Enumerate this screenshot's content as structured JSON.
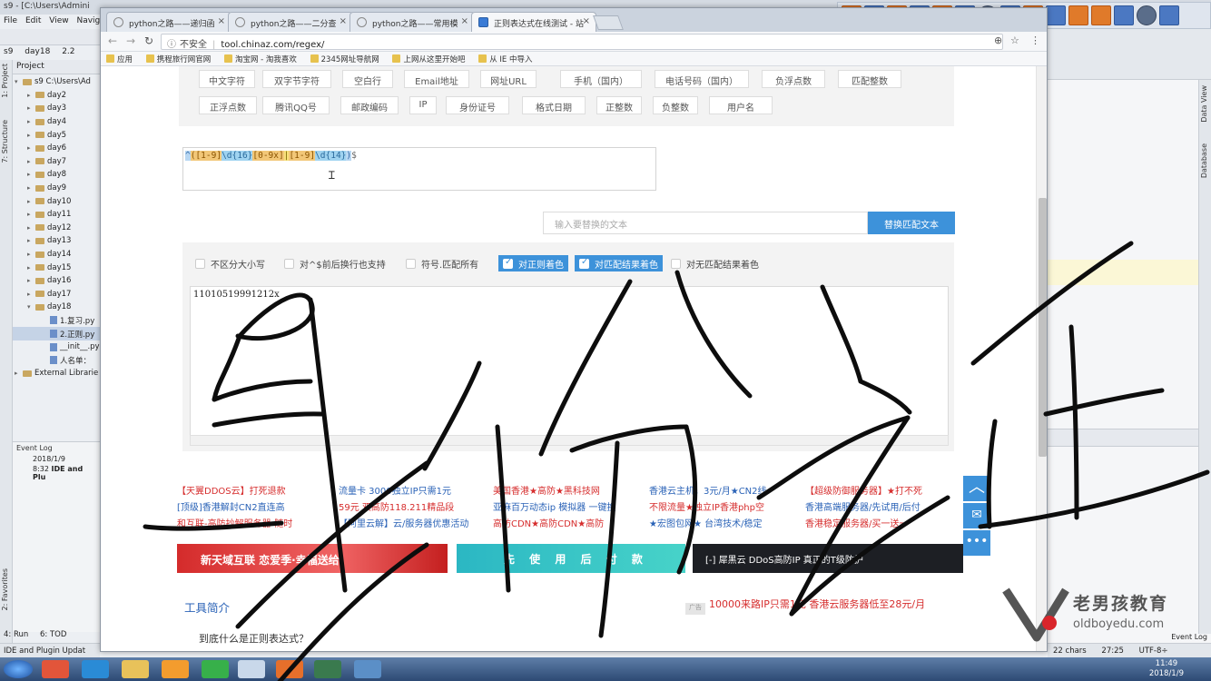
{
  "ide": {
    "title": "s9 - [C:\\Users\\Admini",
    "menu": [
      "File",
      "Edit",
      "View",
      "Navigat"
    ],
    "crumbs": [
      "s9",
      "day18",
      "2.2"
    ],
    "project_label": "Project",
    "tree": [
      {
        "label": "s9  C:\\Users\\Ad",
        "kind": "root",
        "open": true
      },
      {
        "label": "day2",
        "kind": "folder"
      },
      {
        "label": "day3",
        "kind": "folder"
      },
      {
        "label": "day4",
        "kind": "folder"
      },
      {
        "label": "day5",
        "kind": "folder"
      },
      {
        "label": "day6",
        "kind": "folder"
      },
      {
        "label": "day7",
        "kind": "folder"
      },
      {
        "label": "day8",
        "kind": "folder"
      },
      {
        "label": "day9",
        "kind": "folder"
      },
      {
        "label": "day10",
        "kind": "folder"
      },
      {
        "label": "day11",
        "kind": "folder"
      },
      {
        "label": "day12",
        "kind": "folder"
      },
      {
        "label": "day13",
        "kind": "folder"
      },
      {
        "label": "day14",
        "kind": "folder"
      },
      {
        "label": "day15",
        "kind": "folder"
      },
      {
        "label": "day16",
        "kind": "folder"
      },
      {
        "label": "day17",
        "kind": "folder"
      },
      {
        "label": "day18",
        "kind": "folder",
        "open": true
      },
      {
        "label": "1.复习.py",
        "kind": "file"
      },
      {
        "label": "2.正则.py",
        "kind": "file",
        "selected": true
      },
      {
        "label": "__init__.py",
        "kind": "file"
      },
      {
        "label": "人名单：",
        "kind": "file"
      },
      {
        "label": "External Librarie",
        "kind": "lib"
      }
    ],
    "event_log": {
      "title": "Event Log",
      "date": "2018/1/9",
      "time": "8:32",
      "msg": "IDE and Plu"
    },
    "bottom_tabs": [
      "4: Run",
      "6: TOD"
    ],
    "status": "IDE and Plugin Updat",
    "side_labels": [
      "1: Project",
      "7: Structure",
      "2: Favorites"
    ],
    "right_labels": [
      "Data View",
      "Database"
    ],
    "right_status": {
      "chars": "22 chars",
      "pos": "27:25",
      "enc": "UTF-8÷"
    },
    "event_log_btn": "Event Log"
  },
  "browser": {
    "tabs": [
      {
        "label": "python之路——递归函"
      },
      {
        "label": "python之路——二分查"
      },
      {
        "label": "python之路——常用模"
      },
      {
        "label": "正则表达式在线测试 - 站",
        "active": true
      }
    ],
    "address": {
      "insecure": "不安全",
      "host": "tool.chinaz.com/regex/"
    },
    "bookmarks": [
      "应用",
      "携程旅行网官网",
      "淘宝网 - 淘我喜欢",
      "2345网址导航网",
      "上网从这里开始吧",
      "从 IE 中导入"
    ]
  },
  "regex_tool": {
    "chips_row1": [
      "中文字符",
      "双字节字符",
      "空白行",
      "Email地址",
      "网址URL",
      "手机（国内）",
      "电话号码（国内）",
      "负浮点数",
      "匹配整数"
    ],
    "chips_row2": [
      "正浮点数",
      "腾讯QQ号",
      "邮政编码",
      "IP",
      "身份证号",
      "格式日期",
      "正整数",
      "负整数",
      "用户名"
    ],
    "regex_parts": [
      "^",
      "([1-9]",
      "\\d{16}",
      "[0-9x]",
      "|",
      "[1-9]",
      "\\d{14}",
      ")",
      "$"
    ],
    "replace_placeholder": "输入要替换的文本",
    "replace_button": "替换匹配文本",
    "options": [
      {
        "label": "不区分大小写",
        "checked": false
      },
      {
        "label": "对^$前后换行也支持",
        "checked": false
      },
      {
        "label": "符号.匹配所有",
        "checked": false
      },
      {
        "label": "对正则着色",
        "checked": true
      },
      {
        "label": "对匹配结果着色",
        "checked": true
      },
      {
        "label": "对无匹配结果着色",
        "checked": false
      }
    ],
    "result_text": "11010519991212x"
  },
  "ads": {
    "col1": [
      "【天翼DDOS云】打死退款",
      "[顶级]香港解封CN2直连高",
      "和互联-高防抄解服务器-随时"
    ],
    "col2": [
      "流量卡 3000独立IP只需1元",
      "59元 双高防118.211精品段",
      "【阿里云解】云/服务器优惠活动"
    ],
    "col3": [
      "美国香港★高防★黑科技网",
      "亚麻百万动态ip 模拟器 一键换",
      "高防CDN★高防CDN★高防"
    ],
    "col4": [
      "香港云主机，3元/月★CN2线",
      "不限流量★独立IP香港php空",
      "★宏图包网★ 台湾技术/稳定"
    ],
    "col5": [
      "【超级防御服务器】★打不死",
      "香港高端服务器/先试用/后付",
      "香港稳定服务器/买一送一"
    ],
    "banners": [
      "新天域互联  恋爱季·幸福送给",
      "先 使 用 后 付 款",
      "[-] 犀黑云  DDoS高防IP  真正的T级防护"
    ],
    "tool_title": "工具简介",
    "promo_tag": "广告",
    "promo": "10000来路IP只需1元 香港云服务器低至28元/月",
    "faq": "到底什么是正则表达式？"
  },
  "taskbar": {
    "time": "11:49",
    "date": "2018/1/9"
  },
  "watermark": {
    "cn": "老男孩教育",
    "en": "oldboyedu.com"
  },
  "handwriting": "身份证"
}
